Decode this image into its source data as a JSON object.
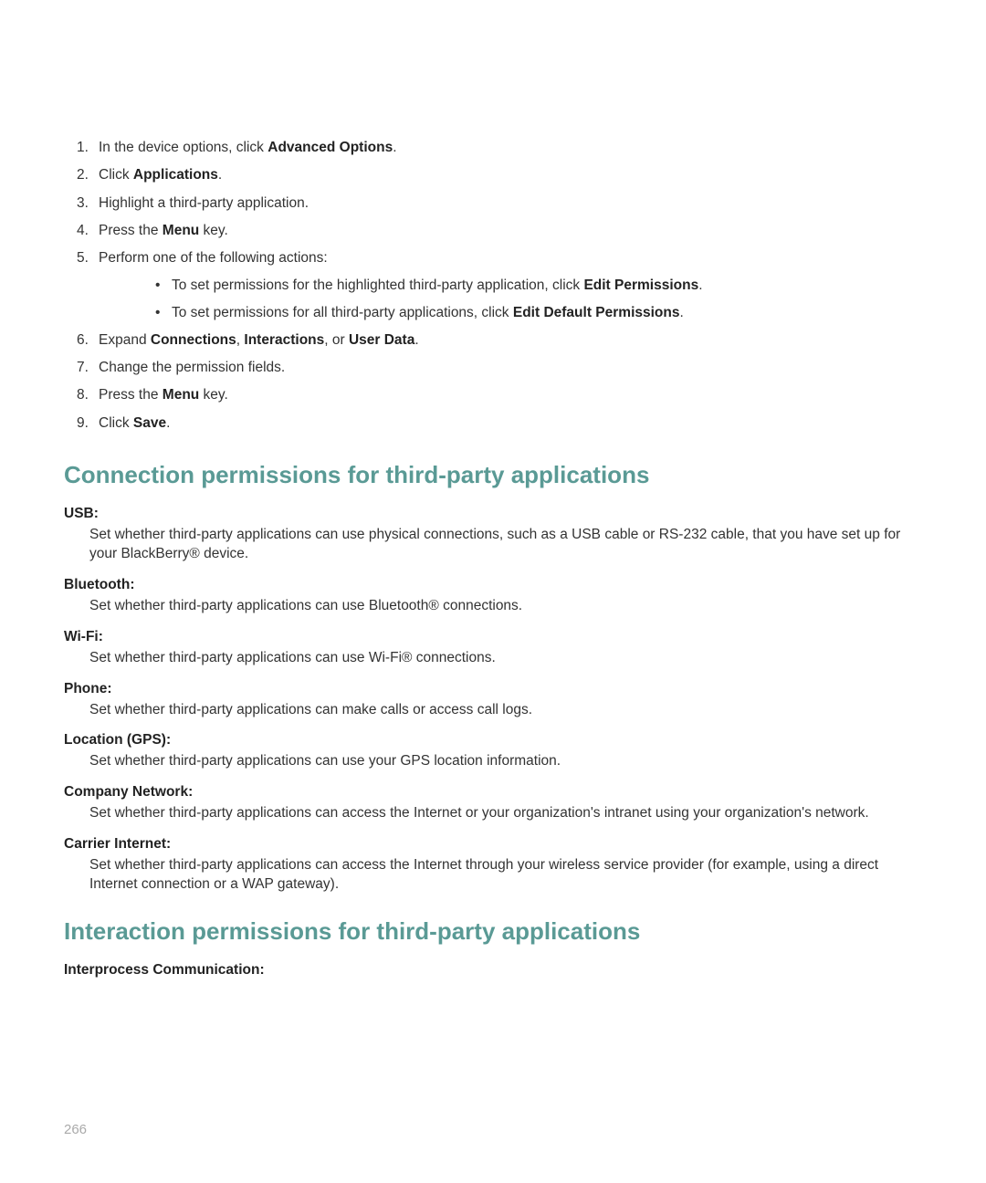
{
  "steps": {
    "s1_a": "In the device options, click ",
    "s1_b": "Advanced Options",
    "s1_c": ".",
    "s2_a": "Click ",
    "s2_b": "Applications",
    "s2_c": ".",
    "s3": "Highlight a third-party application.",
    "s4_a": "Press the ",
    "s4_b": "Menu",
    "s4_c": " key.",
    "s5": "Perform one of the following actions:",
    "s5_sub1_a": "To set permissions for the highlighted third-party application, click ",
    "s5_sub1_b": "Edit Permissions",
    "s5_sub1_c": ".",
    "s5_sub2_a": "To set permissions for all third-party applications, click ",
    "s5_sub2_b": "Edit Default Permissions",
    "s5_sub2_c": ".",
    "s6_a": "Expand ",
    "s6_b": "Connections",
    "s6_c": ", ",
    "s6_d": "Interactions",
    "s6_e": ", or ",
    "s6_f": "User Data",
    "s6_g": ".",
    "s7": "Change the permission fields.",
    "s8_a": "Press the ",
    "s8_b": "Menu",
    "s8_c": " key.",
    "s9_a": "Click ",
    "s9_b": "Save",
    "s9_c": "."
  },
  "section1_title": "Connection permissions for third-party applications",
  "defs1": {
    "usb_t": "USB:",
    "usb_d": "Set whether third-party applications can use physical connections, such as a USB cable or RS-232 cable, that you have set up for your BlackBerry® device.",
    "bt_t": "Bluetooth:",
    "bt_d": "Set whether third-party applications can use Bluetooth® connections.",
    "wifi_t": "Wi-Fi:",
    "wifi_d": "Set whether third-party applications can use Wi-Fi® connections.",
    "phone_t": "Phone:",
    "phone_d": "Set whether third-party applications can make calls or access call logs.",
    "gps_t": "Location (GPS):",
    "gps_d": "Set whether third-party applications can use your GPS location information.",
    "cn_t": "Company Network:",
    "cn_d": "Set whether third-party applications can access the Internet or your organization's intranet using your organization's network.",
    "ci_t": "Carrier Internet:",
    "ci_d": "Set whether third-party applications can access the Internet through your wireless service provider (for example, using a direct Internet connection or a WAP gateway)."
  },
  "section2_title": "Interaction permissions for third-party applications",
  "defs2": {
    "ipc_t": "Interprocess Communication:"
  },
  "page_number": "266"
}
